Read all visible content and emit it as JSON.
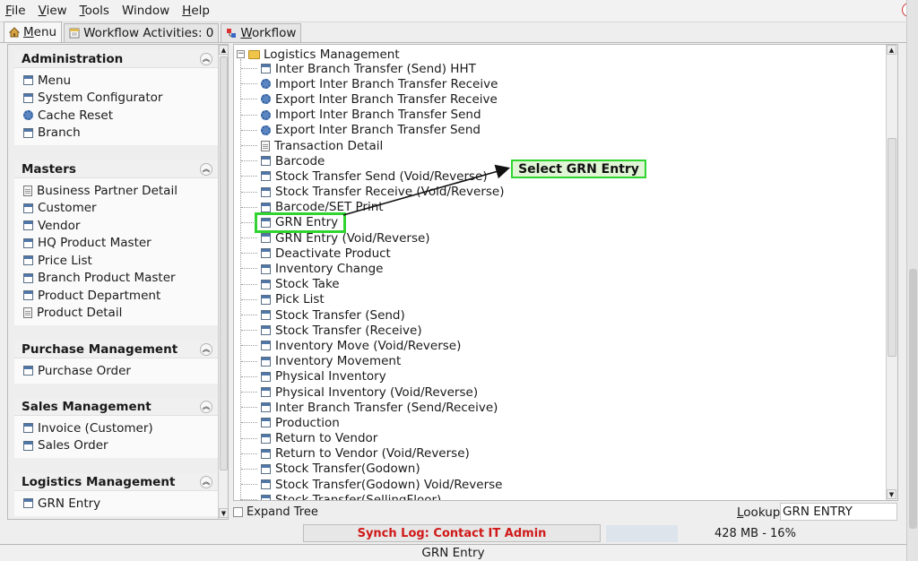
{
  "menubar": {
    "items": [
      {
        "mnemonic": "F",
        "rest": "ile"
      },
      {
        "mnemonic": "V",
        "rest": "iew"
      },
      {
        "mnemonic": "T",
        "rest": "ools"
      },
      {
        "mnemonic": "",
        "rest": "Window"
      },
      {
        "mnemonic": "H",
        "rest": "elp"
      }
    ]
  },
  "tabs": [
    {
      "mnemonic": "M",
      "rest": "enu",
      "icon": "home-icon",
      "active": true
    },
    {
      "label": "Workflow Activities: 0",
      "icon": "workflow-activities-icon",
      "active": false
    },
    {
      "mnemonic": "W",
      "rest": "orkflow",
      "icon": "workflow-icon",
      "active": false
    }
  ],
  "sidebar": {
    "sections": [
      {
        "title": "Administration",
        "items": [
          {
            "label": "Menu",
            "icon": "form-icon"
          },
          {
            "label": "System Configurator",
            "icon": "form-icon"
          },
          {
            "label": "Cache Reset",
            "icon": "gear-icon"
          },
          {
            "label": "Branch",
            "icon": "form-icon"
          }
        ]
      },
      {
        "title": "Masters",
        "items": [
          {
            "label": "Business Partner Detail",
            "icon": "document-icon"
          },
          {
            "label": "Customer",
            "icon": "form-icon"
          },
          {
            "label": "Vendor",
            "icon": "form-icon"
          },
          {
            "label": "HQ Product Master",
            "icon": "form-icon"
          },
          {
            "label": "Price List",
            "icon": "form-icon"
          },
          {
            "label": "Branch Product Master",
            "icon": "form-icon"
          },
          {
            "label": "Product Department",
            "icon": "form-icon"
          },
          {
            "label": "Product Detail",
            "icon": "document-icon"
          }
        ]
      },
      {
        "title": "Purchase Management",
        "items": [
          {
            "label": "Purchase Order",
            "icon": "form-icon"
          }
        ]
      },
      {
        "title": "Sales Management",
        "items": [
          {
            "label": "Invoice (Customer)",
            "icon": "form-icon"
          },
          {
            "label": "Sales Order",
            "icon": "form-icon"
          }
        ]
      },
      {
        "title": "Logistics Management",
        "items": [
          {
            "label": "GRN Entry",
            "icon": "form-icon"
          }
        ]
      }
    ]
  },
  "tree": {
    "root": "Logistics Management",
    "items": [
      {
        "label": "Inter Branch Transfer (Send) HHT",
        "icon": "form-icon"
      },
      {
        "label": "Import Inter Branch Transfer Receive",
        "icon": "gear-icon"
      },
      {
        "label": "Export Inter Branch Transfer Receive",
        "icon": "gear-icon"
      },
      {
        "label": "Import Inter Branch Transfer Send",
        "icon": "gear-icon"
      },
      {
        "label": "Export Inter Branch Transfer Send",
        "icon": "gear-icon"
      },
      {
        "label": "Transaction Detail",
        "icon": "document-icon"
      },
      {
        "label": "Barcode",
        "icon": "form-icon"
      },
      {
        "label": "Stock Transfer Send (Void/Reverse)",
        "icon": "form-icon"
      },
      {
        "label": "Stock Transfer Receive (Void/Reverse)",
        "icon": "form-icon"
      },
      {
        "label": "Barcode/SET Print",
        "icon": "form-icon"
      },
      {
        "label": "GRN Entry",
        "icon": "form-icon",
        "highlight": true
      },
      {
        "label": "GRN Entry (Void/Reverse)",
        "icon": "form-icon"
      },
      {
        "label": "Deactivate Product",
        "icon": "form-icon"
      },
      {
        "label": "Inventory Change",
        "icon": "form-icon"
      },
      {
        "label": "Stock Take",
        "icon": "form-icon"
      },
      {
        "label": "Pick List",
        "icon": "form-icon"
      },
      {
        "label": "Stock Transfer (Send)",
        "icon": "form-icon"
      },
      {
        "label": "Stock Transfer (Receive)",
        "icon": "form-icon"
      },
      {
        "label": "Inventory Move (Void/Reverse)",
        "icon": "form-icon"
      },
      {
        "label": "Inventory Movement",
        "icon": "form-icon"
      },
      {
        "label": "Physical Inventory",
        "icon": "form-icon"
      },
      {
        "label": "Physical Inventory (Void/Reverse)",
        "icon": "form-icon"
      },
      {
        "label": "Inter Branch Transfer (Send/Receive)",
        "icon": "form-icon"
      },
      {
        "label": "Production",
        "icon": "form-icon"
      },
      {
        "label": "Return to Vendor",
        "icon": "form-icon"
      },
      {
        "label": "Return to Vendor (Void/Reverse)",
        "icon": "form-icon"
      },
      {
        "label": "Stock Transfer(Godown)",
        "icon": "form-icon"
      },
      {
        "label": "Stock Transfer(Godown) Void/Reverse",
        "icon": "form-icon"
      },
      {
        "label": "Stock Transfer(SellingFloor)",
        "icon": "form-icon"
      }
    ]
  },
  "annotation": {
    "callout_text": "Select GRN Entry",
    "color": "#2fd42f"
  },
  "bottom": {
    "expand_tree_label": "Expand Tree",
    "lookup_mnemonic": "L",
    "lookup_rest": "ookup",
    "lookup_value": "GRN ENTRY"
  },
  "status": {
    "synch_log": "Synch Log: Contact IT Admin",
    "memory": "428 MB - 16%"
  },
  "footer": {
    "title": "GRN Entry"
  }
}
